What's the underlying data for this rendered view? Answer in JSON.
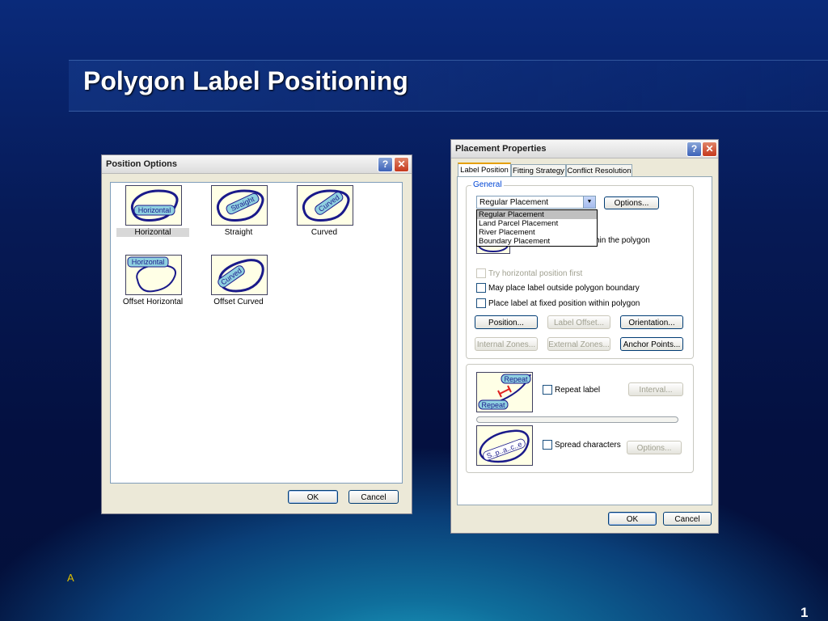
{
  "slide": {
    "title": "Polygon Label Positioning",
    "footer": "A",
    "page": "1"
  },
  "position_options": {
    "title": "Position Options",
    "help": "?",
    "close": "✕",
    "options": [
      {
        "label": "Horizontal",
        "tile_text": "Horizontal",
        "selected": true
      },
      {
        "label": "Straight",
        "tile_text": "Straight"
      },
      {
        "label": "Curved",
        "tile_text": "Curved"
      },
      {
        "label": "Offset Horizontal",
        "tile_text": "Horizontal"
      },
      {
        "label": "Offset Curved",
        "tile_text": "Curved"
      }
    ],
    "ok": "OK",
    "cancel": "Cancel"
  },
  "placement_properties": {
    "title": "Placement Properties",
    "help": "?",
    "close": "✕",
    "tabs": [
      "Label Position",
      "Fitting Strategy",
      "Conflict Resolution"
    ],
    "general_title": "General",
    "combo_value": "Regular Placement",
    "dropdown_items": [
      "Regular Placement",
      "Land Parcel Placement",
      "River Placement",
      "Boundary Placement"
    ],
    "partial_text": "hin the polygon",
    "options_button": "Options...",
    "try_horizontal": "Try horizontal position first",
    "may_place_outside": "May place label outside polygon boundary",
    "fixed_position": "Place label at fixed position within polygon",
    "buttons": {
      "position": "Position...",
      "label_offset": "Label Offset...",
      "orientation": "Orientation...",
      "internal_zones": "Internal Zones...",
      "external_zones": "External Zones...",
      "anchor_points": "Anchor Points..."
    },
    "repeat_tile_top": "Repeat",
    "repeat_tile_bottom": "Repeat",
    "repeat_label": "Repeat label",
    "interval": "Interval...",
    "spread_tile_text": "S..p..a..c..e",
    "spread_characters": "Spread characters",
    "spread_options": "Options...",
    "ok": "OK",
    "cancel": "Cancel"
  }
}
